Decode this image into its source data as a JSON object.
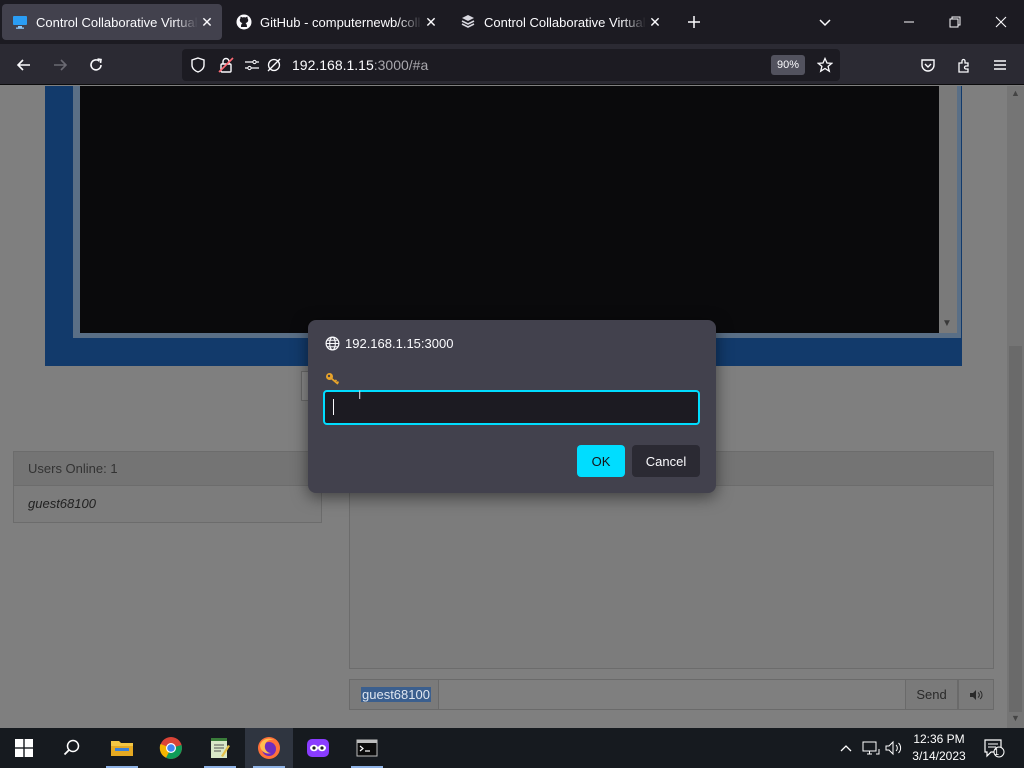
{
  "browser": {
    "tabs": [
      {
        "label": "Control Collaborative Virtual Machines",
        "active": true,
        "icon": "monitor-icon"
      },
      {
        "label": "GitHub - computernewb/collab-vm",
        "active": false,
        "icon": "github-icon"
      },
      {
        "label": "Control Collaborative Virtual Machines",
        "active": false,
        "icon": "vm-stack-icon"
      }
    ],
    "url_host": "192.168.1.15",
    "url_rest": ":3000/#a",
    "zoom": "90%"
  },
  "page": {
    "users_online_label": "Users Online: 1",
    "users": [
      "guest68100"
    ],
    "chat_username": "guest68100",
    "send_label": "Send"
  },
  "modal": {
    "origin": "192.168.1.15:3000",
    "input_value": "",
    "ok_label": "OK",
    "cancel_label": "Cancel"
  },
  "taskbar": {
    "time": "12:36 PM",
    "date": "3/14/2023",
    "notification_count": "1"
  },
  "colors": {
    "accent": "#00ddff",
    "browser_bg": "#1c1b22",
    "modal_bg": "#42414d",
    "vm_frame": "#1f5fa8"
  }
}
